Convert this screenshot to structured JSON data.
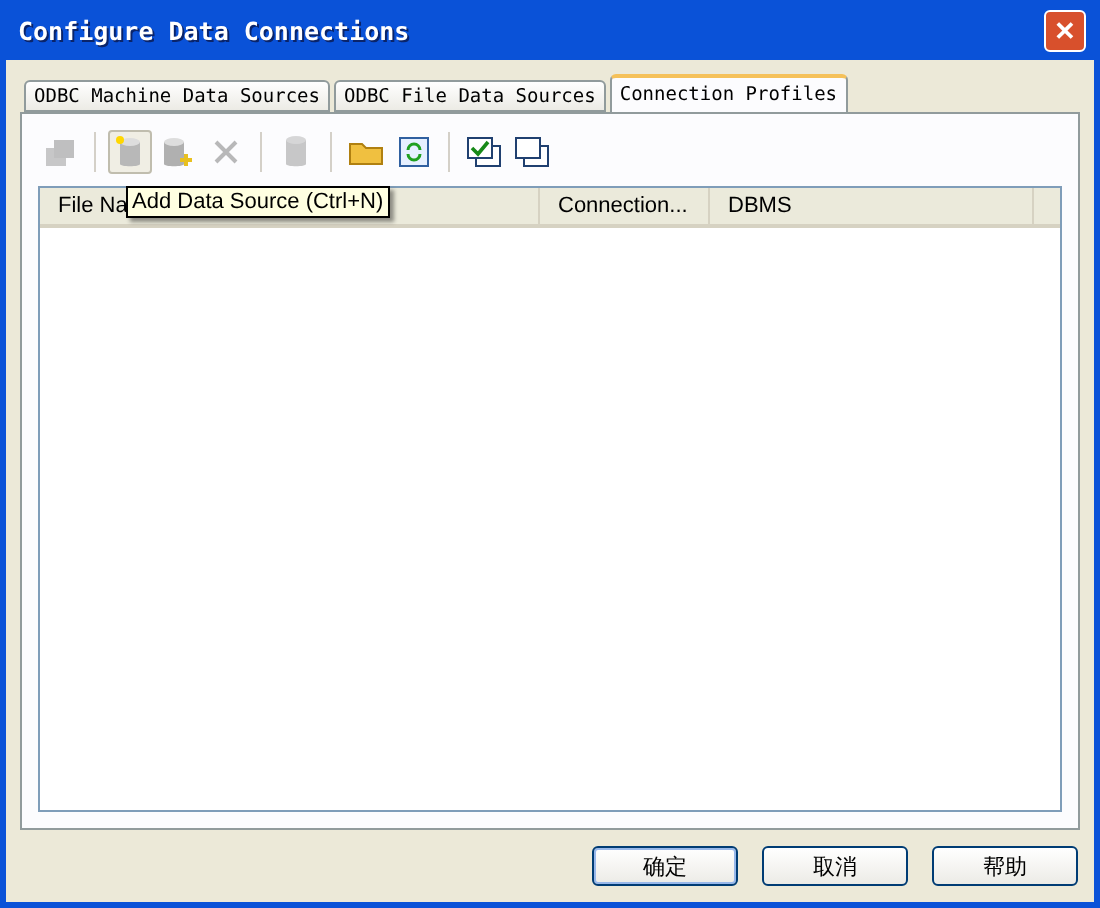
{
  "window": {
    "title": "Configure Data Connections",
    "close": "✕"
  },
  "tabs": [
    {
      "label": "ODBC Machine Data Sources",
      "selected": false
    },
    {
      "label": "ODBC File Data Sources",
      "selected": false
    },
    {
      "label": "Connection Profiles",
      "selected": true
    }
  ],
  "toolbar": [
    {
      "kind": "connect",
      "disabled": true,
      "hovered": false
    },
    {
      "kind": "separator"
    },
    {
      "kind": "new-db",
      "disabled": false,
      "hovered": true
    },
    {
      "kind": "add-db",
      "disabled": false,
      "hovered": false
    },
    {
      "kind": "delete",
      "disabled": true,
      "hovered": false
    },
    {
      "kind": "separator"
    },
    {
      "kind": "cylinder",
      "disabled": true,
      "hovered": false
    },
    {
      "kind": "separator"
    },
    {
      "kind": "folder",
      "disabled": false,
      "hovered": false
    },
    {
      "kind": "refresh",
      "disabled": false,
      "hovered": false
    },
    {
      "kind": "separator"
    },
    {
      "kind": "check-stack",
      "disabled": false,
      "hovered": false
    },
    {
      "kind": "stack",
      "disabled": false,
      "hovered": false
    }
  ],
  "tooltip": "Add Data Source (Ctrl+N)",
  "table": {
    "columns": [
      "File Na",
      "Connection...",
      "DBMS"
    ]
  },
  "buttons": [
    {
      "label": "确定",
      "default": true
    },
    {
      "label": "取消",
      "default": false
    },
    {
      "label": "帮助",
      "default": false
    }
  ]
}
